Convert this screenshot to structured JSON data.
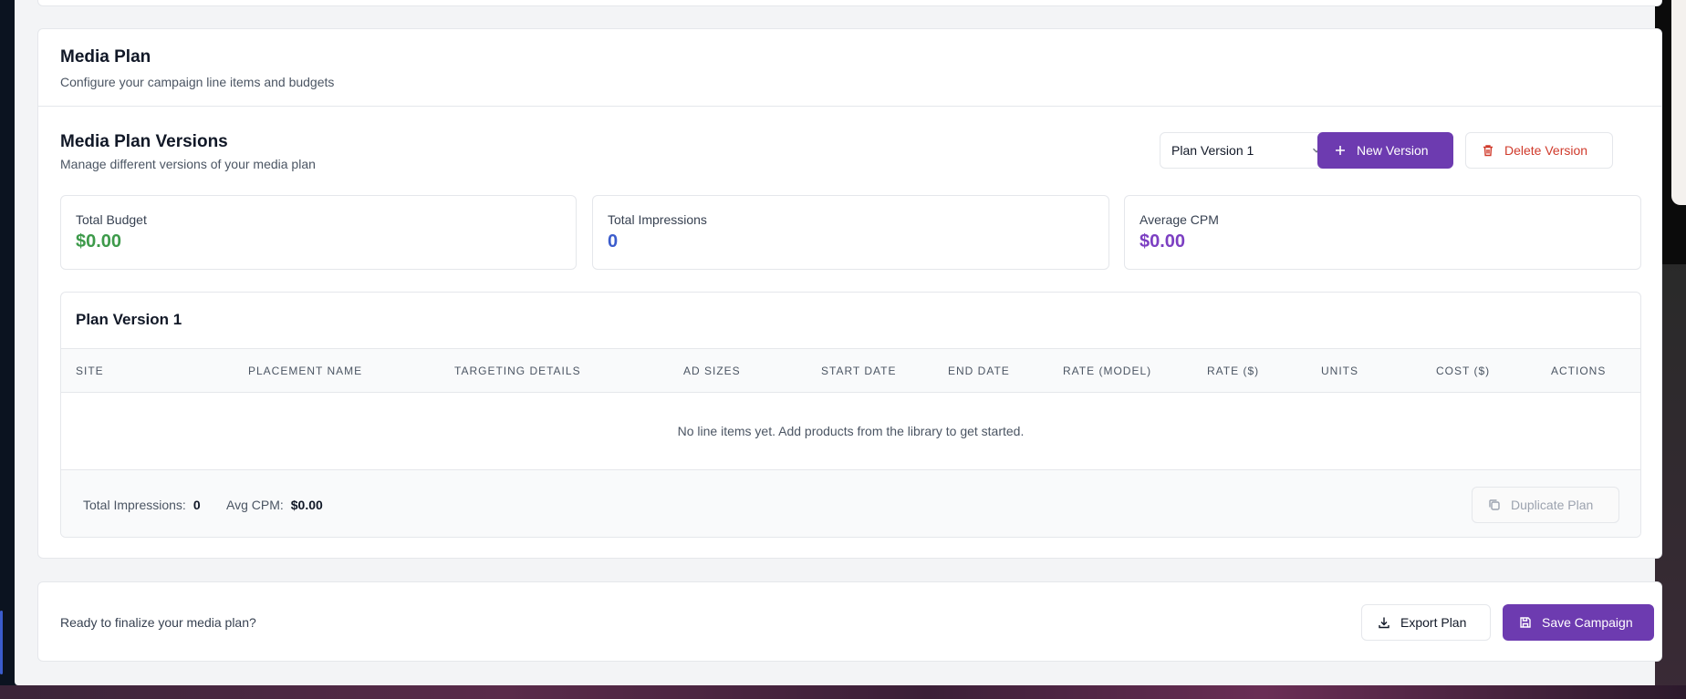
{
  "media_plan": {
    "title": "Media Plan",
    "subtitle": "Configure your campaign line items and budgets"
  },
  "versions": {
    "title": "Media Plan Versions",
    "subtitle": "Manage different versions of your media plan",
    "selected_version": "Plan Version 1",
    "new_version_label": "New Version",
    "delete_version_label": "Delete Version"
  },
  "stats": [
    {
      "label": "Total Budget",
      "value": "$0.00",
      "color": "#3d9a4a"
    },
    {
      "label": "Total Impressions",
      "value": "0",
      "color": "#3b5ccc"
    },
    {
      "label": "Average CPM",
      "value": "$0.00",
      "color": "#7c3fc2"
    }
  ],
  "plan_table": {
    "title": "Plan Version 1",
    "columns": [
      "Site",
      "Placement Name",
      "Targeting Details",
      "Ad Sizes",
      "Start Date",
      "End Date",
      "Rate (Model)",
      "Rate ($)",
      "Units",
      "Cost ($)",
      "Actions"
    ],
    "empty_message": "No line items yet. Add products from the library to get started.",
    "footer": {
      "total_impressions_label": "Total Impressions:",
      "total_impressions_value": "0",
      "avg_cpm_label": "Avg CPM:",
      "avg_cpm_value": "$0.00",
      "duplicate_label": "Duplicate Plan"
    }
  },
  "finalize": {
    "prompt": "Ready to finalize your media plan?",
    "export_label": "Export Plan",
    "save_label": "Save Campaign"
  },
  "colors": {
    "primary": "#6d3bb0",
    "danger": "#d03a2b"
  }
}
